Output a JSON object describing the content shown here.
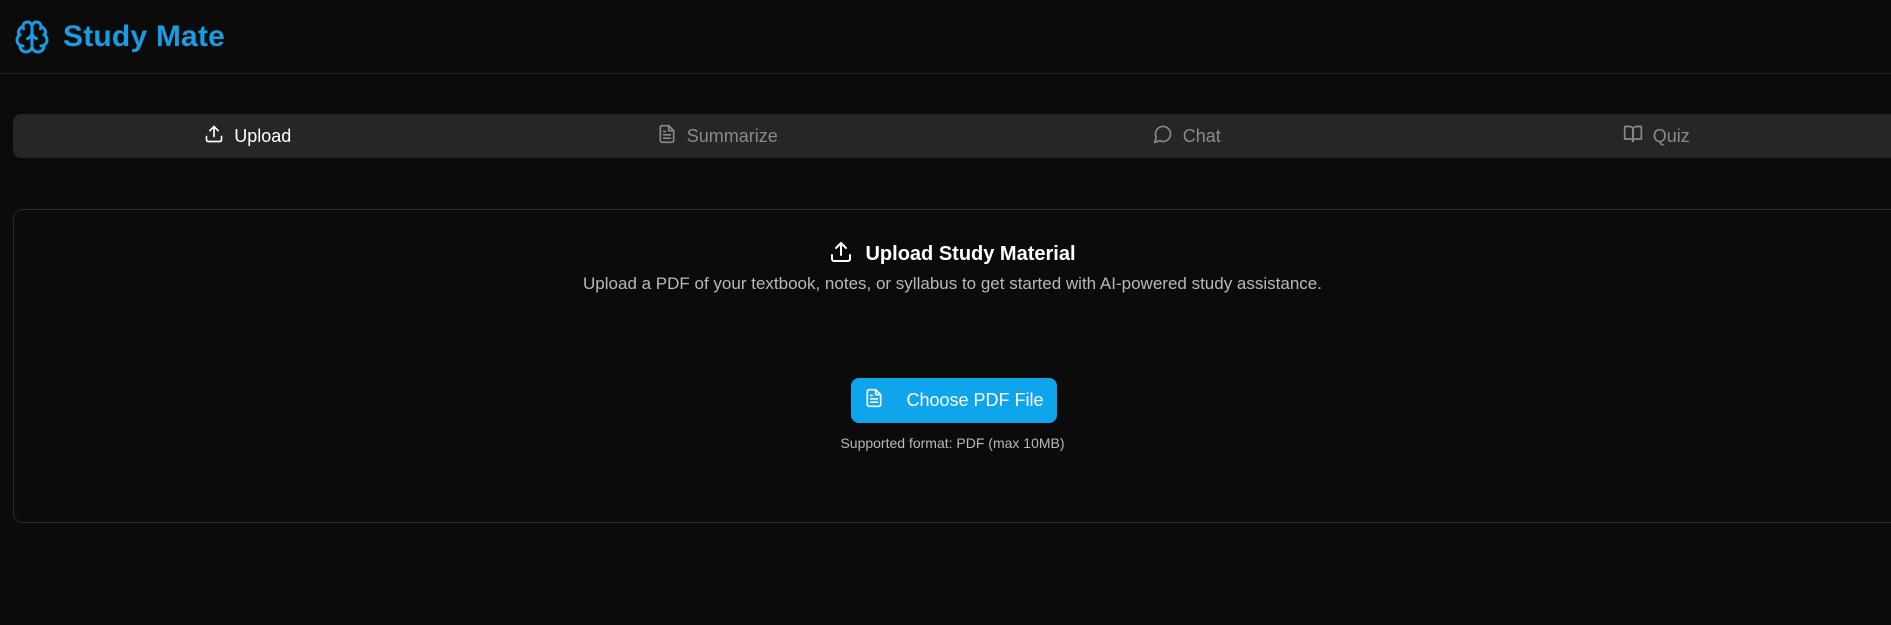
{
  "app": {
    "title": "Study Mate",
    "brand_color": "#1a9ce4",
    "logo_icon": "brain-icon"
  },
  "tabs": [
    {
      "label": "Upload",
      "icon": "upload-icon",
      "active": true
    },
    {
      "label": "Summarize",
      "icon": "file-text-icon",
      "active": false
    },
    {
      "label": "Chat",
      "icon": "message-circle-icon",
      "active": false
    },
    {
      "label": "Quiz",
      "icon": "book-open-icon",
      "active": false
    }
  ],
  "upload_card": {
    "title": "Upload Study Material",
    "description": "Upload a PDF of your textbook, notes, or syllabus to get started with AI-powered study assistance.",
    "button_label": "Choose PDF File",
    "button_color": "#0ea5ec",
    "supported_text": "Supported format: PDF (max 10MB)"
  }
}
